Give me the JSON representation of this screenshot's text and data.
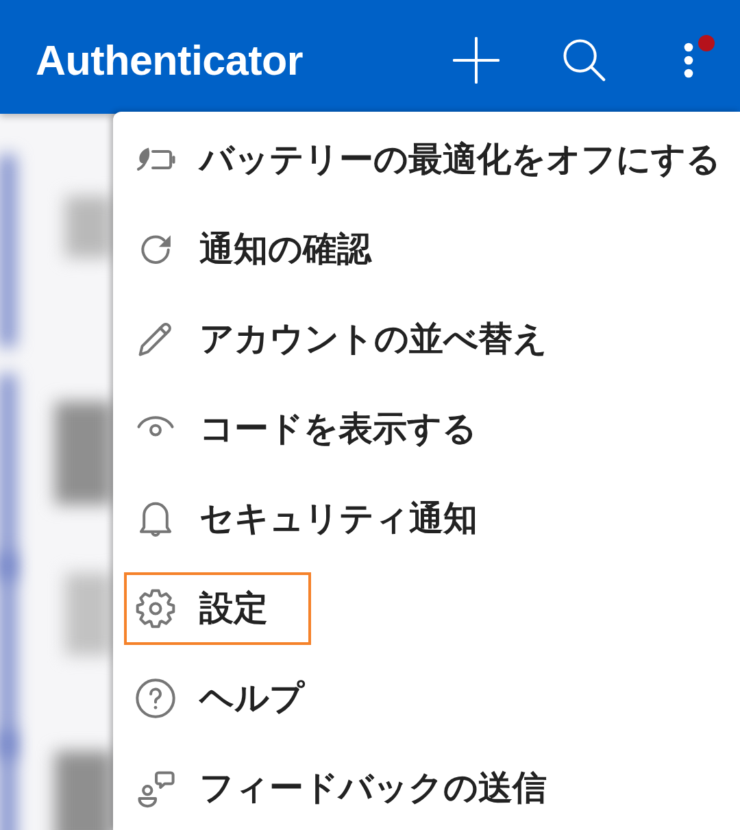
{
  "app_bar": {
    "title": "Authenticator",
    "menu_badge": true
  },
  "menu": {
    "items": [
      {
        "label": "バッテリーの最適化をオフにする",
        "highlighted": false
      },
      {
        "label": "通知の確認",
        "highlighted": false
      },
      {
        "label": "アカウントの並べ替え",
        "highlighted": false
      },
      {
        "label": "コードを表示する",
        "highlighted": false
      },
      {
        "label": "セキュリティ通知",
        "highlighted": false
      },
      {
        "label": "設定",
        "highlighted": true
      },
      {
        "label": "ヘルプ",
        "highlighted": false
      },
      {
        "label": "フィードバックの送信",
        "highlighted": false
      }
    ]
  }
}
